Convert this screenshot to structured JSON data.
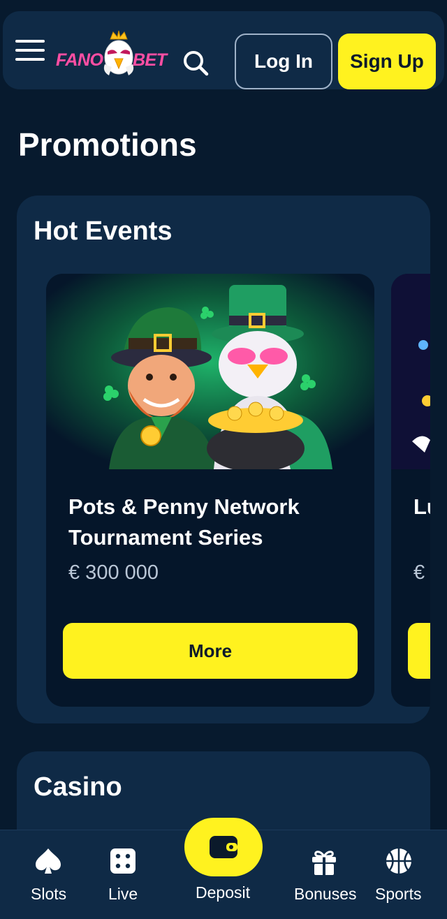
{
  "header": {
    "logo_left": "FANO",
    "logo_right": "BET",
    "login_label": "Log In",
    "signup_label": "Sign Up"
  },
  "page": {
    "title": "Promotions"
  },
  "hot_events": {
    "title": "Hot Events",
    "cards": [
      {
        "title": "Pots & Penny Network Tournament Series",
        "prize": "€ 300 000",
        "button": "More"
      },
      {
        "title": "Lu C",
        "prize": "€",
        "button": ""
      }
    ]
  },
  "casino": {
    "title": "Casino"
  },
  "bottom_nav": {
    "items": [
      {
        "label": "Slots",
        "icon": "spade-icon"
      },
      {
        "label": "Live",
        "icon": "dice-icon"
      },
      {
        "label": "Deposit",
        "icon": "wallet-icon"
      },
      {
        "label": "Bonuses",
        "icon": "gift-icon"
      },
      {
        "label": "Sports",
        "icon": "basketball-icon"
      }
    ]
  },
  "colors": {
    "background": "#071a2e",
    "panel": "#0f2a46",
    "card": "#05162a",
    "accent_yellow": "#fff21f",
    "logo_pink": "#ff4fa3"
  }
}
